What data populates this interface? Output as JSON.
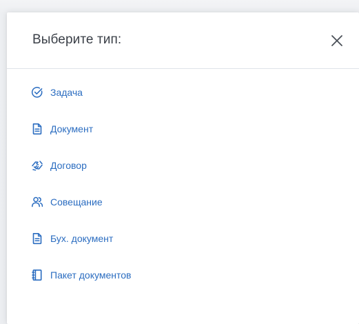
{
  "dialog": {
    "title": "Выберите тип:",
    "close_icon": "close-icon"
  },
  "items": [
    {
      "label": "Задача",
      "icon": "check-circle-icon"
    },
    {
      "label": "Документ",
      "icon": "document-icon"
    },
    {
      "label": "Договор",
      "icon": "handshake-icon"
    },
    {
      "label": "Совещание",
      "icon": "people-icon"
    },
    {
      "label": "Бух. документ",
      "icon": "document-icon"
    },
    {
      "label": "Пакет документов",
      "icon": "book-icon"
    }
  ],
  "colors": {
    "accent": "#2a6cc0",
    "title": "#3a3f47",
    "close": "#4a4f57",
    "divider": "#dfe3e8"
  }
}
